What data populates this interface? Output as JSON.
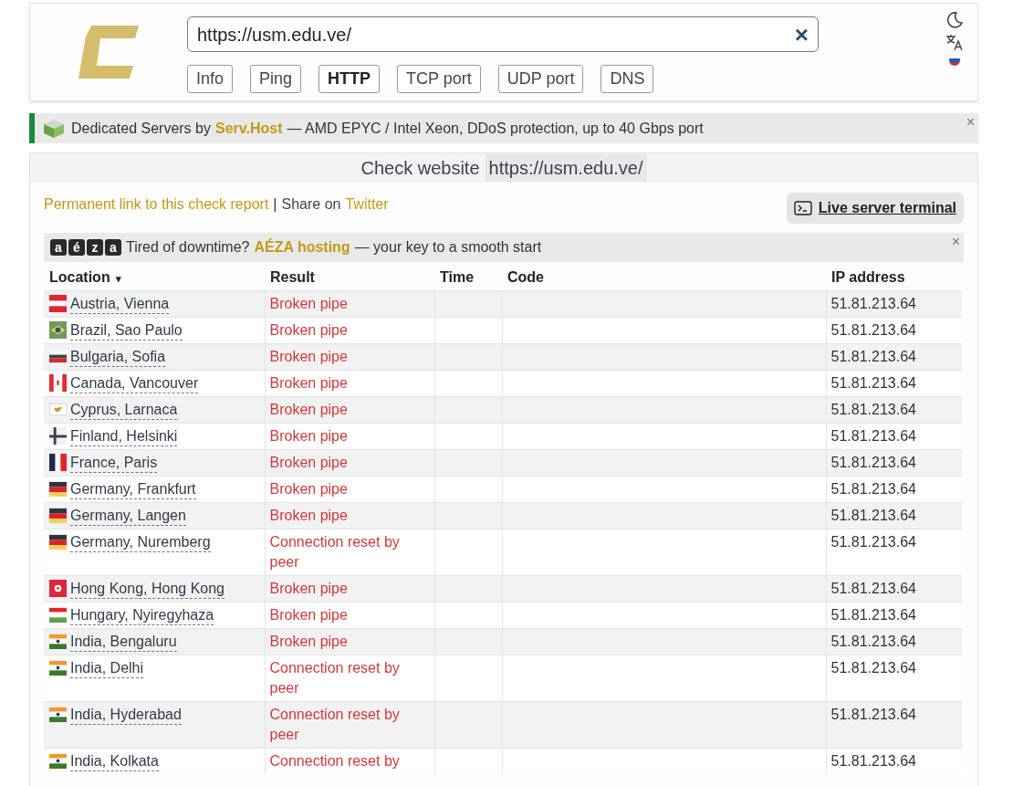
{
  "header": {
    "url": "https://usm.edu.ve/",
    "clear_glyph": "×",
    "tabs": [
      {
        "label": "Info",
        "selected": false
      },
      {
        "label": "Ping",
        "selected": false
      },
      {
        "label": "HTTP",
        "selected": true
      },
      {
        "label": "TCP port",
        "selected": false
      },
      {
        "label": "UDP port",
        "selected": false
      },
      {
        "label": "DNS",
        "selected": false
      }
    ]
  },
  "ad_banner": {
    "prefix": "Dedicated Servers by",
    "link": "Serv.Host",
    "suffix": "— AMD EPYC / Intel Xeon, DDoS protection, up to 40 Gbps port",
    "close": "×"
  },
  "check": {
    "title": "Check website",
    "url": "https://usm.edu.ve/",
    "permalink": "Permanent link to this check report",
    "separator": "|",
    "share_prefix": "Share on",
    "share_link": "Twitter",
    "terminal_button": "Live server terminal",
    "aeza_banner": {
      "letters": [
        "a",
        "é",
        "z",
        "a"
      ],
      "prefix": "Tired of downtime?",
      "link": "AÉZA hosting",
      "suffix": "— your key to a smooth start",
      "close": "×"
    },
    "table": {
      "columns": [
        "Location",
        "Result",
        "Time",
        "Code",
        "IP address"
      ],
      "sort_indicator": "▾",
      "rows": [
        {
          "kind": "at",
          "location": "Austria, Vienna",
          "result": "Broken pipe",
          "ip": "51.81.213.64"
        },
        {
          "kind": "br",
          "location": "Brazil, Sao Paulo",
          "result": "Broken pipe",
          "ip": "51.81.213.64"
        },
        {
          "kind": "bg",
          "location": "Bulgaria, Sofia",
          "result": "Broken pipe",
          "ip": "51.81.213.64"
        },
        {
          "kind": "ca",
          "location": "Canada, Vancouver",
          "result": "Broken pipe",
          "ip": "51.81.213.64"
        },
        {
          "kind": "cy",
          "location": "Cyprus, Larnaca",
          "result": "Broken pipe",
          "ip": "51.81.213.64"
        },
        {
          "kind": "fi",
          "location": "Finland, Helsinki",
          "result": "Broken pipe",
          "ip": "51.81.213.64"
        },
        {
          "kind": "fr",
          "location": "France, Paris",
          "result": "Broken pipe",
          "ip": "51.81.213.64"
        },
        {
          "kind": "de",
          "location": "Germany, Frankfurt",
          "result": "Broken pipe",
          "ip": "51.81.213.64"
        },
        {
          "kind": "de",
          "location": "Germany, Langen",
          "result": "Broken pipe",
          "ip": "51.81.213.64"
        },
        {
          "kind": "de",
          "location": "Germany, Nuremberg",
          "result": "Connection reset by peer",
          "ip": "51.81.213.64"
        },
        {
          "kind": "hk",
          "location": "Hong Kong, Hong Kong",
          "result": "Broken pipe",
          "ip": "51.81.213.64"
        },
        {
          "kind": "hu",
          "location": "Hungary, Nyiregyhaza",
          "result": "Broken pipe",
          "ip": "51.81.213.64"
        },
        {
          "kind": "in",
          "location": "India, Bengaluru",
          "result": "Broken pipe",
          "ip": "51.81.213.64"
        },
        {
          "kind": "in",
          "location": "India, Delhi",
          "result": "Connection reset by peer",
          "ip": "51.81.213.64"
        },
        {
          "kind": "in",
          "location": "India, Hyderabad",
          "result": "Connection reset by peer",
          "ip": "51.81.213.64"
        },
        {
          "kind": "in",
          "location": "India, Kolkata",
          "result": "Connection reset by",
          "ip": "51.81.213.64"
        }
      ]
    }
  }
}
